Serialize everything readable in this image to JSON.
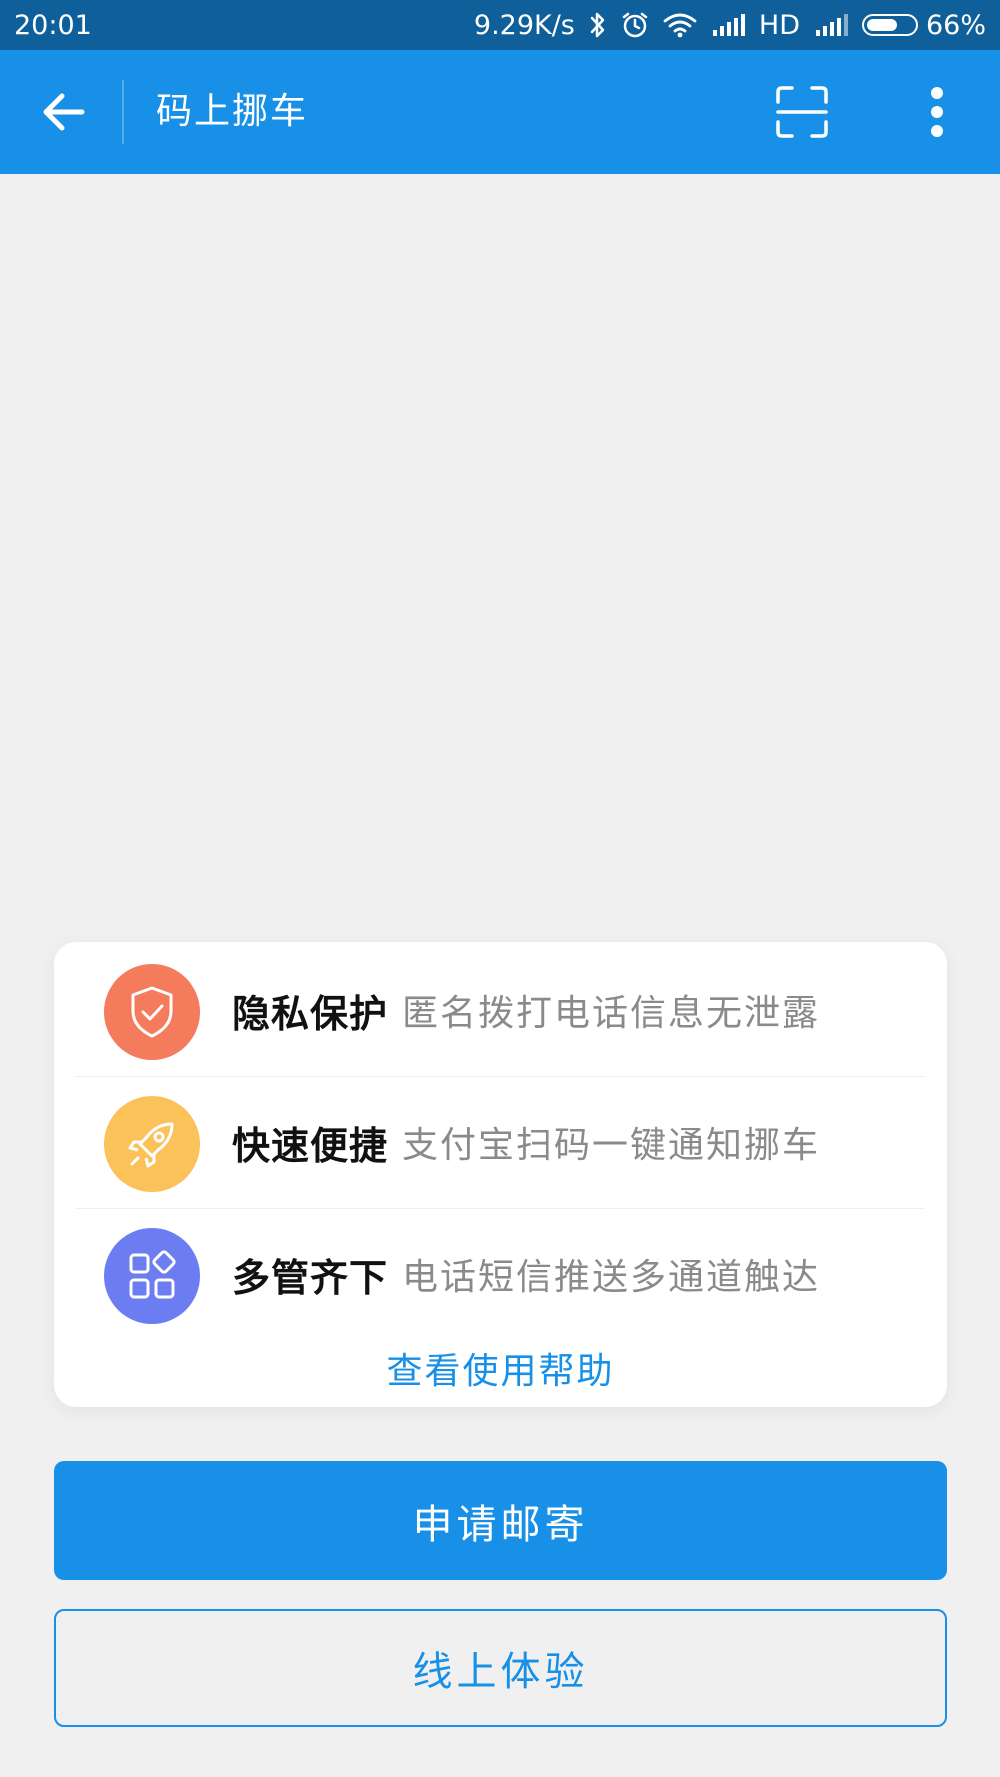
{
  "status_bar": {
    "time": "20:01",
    "network_speed": "9.29K/s",
    "hd_label": "HD",
    "battery_text": "66%",
    "battery_level": 0.66,
    "icons": [
      "bluetooth-icon",
      "alarm-icon",
      "wifi-icon",
      "signal-icon",
      "signal-icon",
      "battery-icon"
    ]
  },
  "app_bar": {
    "title": "码上挪车",
    "icons": [
      "back-arrow-icon",
      "scan-icon",
      "more-vertical-icon"
    ]
  },
  "features": [
    {
      "title": "隐私保护",
      "desc": "匿名拨打电话信息无泄露",
      "icon": "shield-check-icon",
      "color": "#f47b5c"
    },
    {
      "title": "快速便捷",
      "desc": "支付宝扫码一键通知挪车",
      "icon": "rocket-icon",
      "color": "#fbc25a"
    },
    {
      "title": "多管齐下",
      "desc": "电话短信推送多通道触达",
      "icon": "grid-apps-icon",
      "color": "#6c7df2"
    }
  ],
  "help_link": "查看使用帮助",
  "primary_button": "申请邮寄",
  "secondary_button": "线上体验",
  "colors": {
    "status_bar": "#0e5f9a",
    "app_bar": "#1890e8",
    "background": "#f0f0f0",
    "accent": "#1890e8"
  }
}
